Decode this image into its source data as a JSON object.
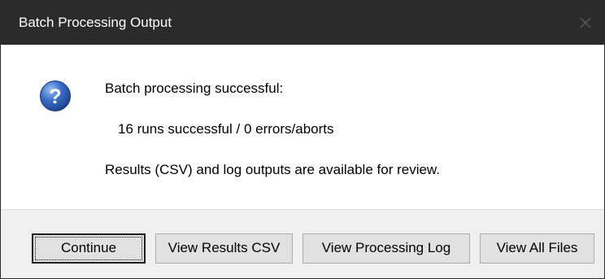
{
  "window": {
    "title": "Batch Processing Output",
    "close_icon": "close-icon"
  },
  "dialog": {
    "icon": "question-icon",
    "line1": "Batch processing successful:",
    "line2": "16 runs successful / 0 errors/aborts",
    "line3": "Results (CSV) and log outputs are available for review."
  },
  "buttons": {
    "continue": "Continue",
    "view_csv": "View Results CSV",
    "view_log": "View Processing Log",
    "view_all": "View All Files"
  },
  "colors": {
    "titlebar": "#2b2b2b",
    "footer": "#f0f0f0",
    "button": "#e1e1e1",
    "icon_blue": "#2a5bb0"
  }
}
